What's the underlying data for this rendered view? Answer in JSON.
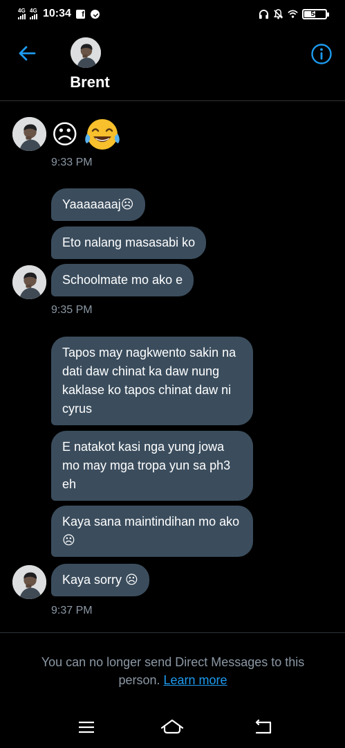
{
  "status_bar": {
    "time": "10:34",
    "network_1": "4G",
    "network_2": "4G",
    "battery": "54",
    "icons": [
      "signal-icon",
      "facebook-icon",
      "messenger-icon",
      "headphones-icon",
      "mute-bell-icon",
      "wifi-icon",
      "battery-icon"
    ]
  },
  "header": {
    "name": "Brent",
    "back_icon": "back-arrow-icon",
    "info_icon": "info-icon",
    "accent_color": "#1d9bf0"
  },
  "conversation": {
    "groups": [
      {
        "emojis": [
          "☹",
          "😂"
        ],
        "time": "9:33 PM"
      },
      {
        "messages": [
          "Yaaaaaaaj☹",
          "Eto nalang masasabi ko",
          "Schoolmate mo ako e"
        ],
        "time": "9:35 PM"
      },
      {
        "messages": [
          "Tapos may nagkwento sakin na dati daw chinat ka daw nung kaklase ko tapos chinat daw ni cyrus",
          "E natakot kasi nga yung jowa mo may mga tropa yun sa ph3 eh",
          "Kaya sana maintindihan mo ako ☹",
          "Kaya sorry ☹"
        ],
        "time": "9:37 PM"
      }
    ],
    "bubble_color": "#3b4d5d"
  },
  "footer": {
    "notice": "You can no longer send Direct Messages to this person.",
    "link": "Learn more"
  },
  "navbar": {
    "icons": [
      "menu-icon",
      "home-icon",
      "back-icon"
    ]
  }
}
